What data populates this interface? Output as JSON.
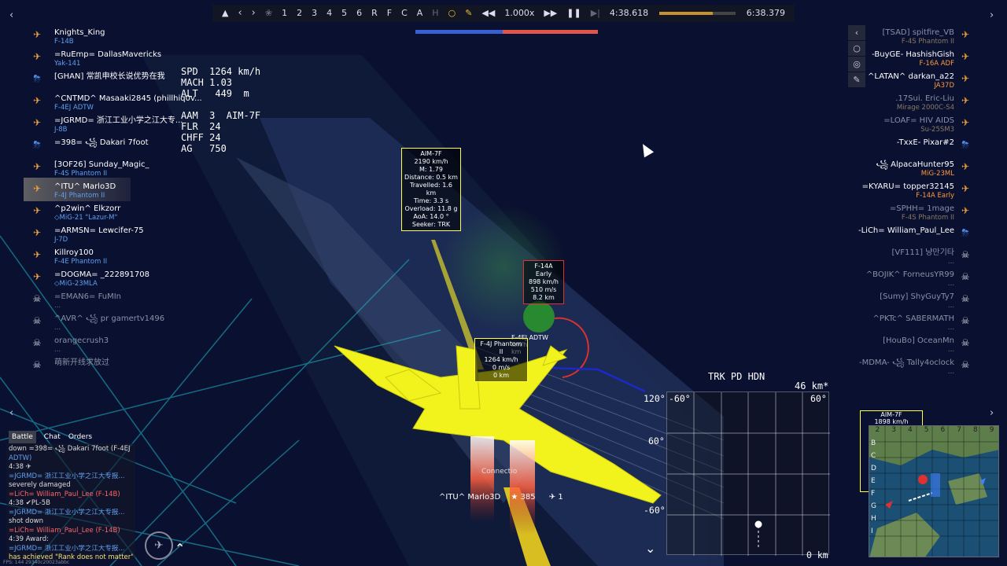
{
  "replay": {
    "items": [
      "1",
      "2",
      "3",
      "4",
      "5",
      "6",
      "R",
      "F",
      "C",
      "A"
    ],
    "speed": "1.000x",
    "current_time": "4:38.618",
    "total_time": "6:38.379",
    "progress": 0.7
  },
  "left_players": [
    {
      "name": "Knights_King",
      "vehicle": "F-14B",
      "state": "alive"
    },
    {
      "name": "=RuEmp= DallasMavericks",
      "vehicle": "Yak-141",
      "state": "alive"
    },
    {
      "name": "[GHAN] 常凯申校长说优势在我",
      "vehicle": "",
      "state": "para"
    },
    {
      "name": "^CNTMD^ Masaaki2845 (phillhiq0v...",
      "vehicle": "F-4EJ ADTW",
      "state": "alive"
    },
    {
      "name": "=JGRMD= 浙江工业小学之江大专...",
      "vehicle": "J-8B",
      "state": "alive"
    },
    {
      "name": "=398= ꧁ Dakari 7foot",
      "vehicle": "",
      "state": "para"
    },
    {
      "name": "[3OF26] Sunday_Magic_",
      "vehicle": "F-4S Phantom II",
      "state": "alive"
    },
    {
      "name": "^ITU^ Marlo3D",
      "vehicle": "F-4J Phantom II",
      "state": "alive"
    },
    {
      "name": "^p2win^ Elkzorr",
      "vehicle": "◇MiG-21 \"Lazur-M\"",
      "state": "alive"
    },
    {
      "name": "=ARMSN= Lewcifer-75",
      "vehicle": "J-7D",
      "state": "alive"
    },
    {
      "name": "Killroy100",
      "vehicle": "F-4E Phantom II",
      "state": "alive"
    },
    {
      "name": "=DOGMA= _222891708",
      "vehicle": "◇MiG-23MLA",
      "state": "alive"
    },
    {
      "name": "=EMAN6= FuMIn",
      "vehicle": "...",
      "state": "dead"
    },
    {
      "name": "^AVR^ ꧁ pr gamertv1496",
      "vehicle": "...",
      "state": "dead"
    },
    {
      "name": "orangecrush3",
      "vehicle": "...",
      "state": "dead"
    },
    {
      "name": "萌新开线求放过",
      "vehicle": "",
      "state": "dead"
    }
  ],
  "right_players": [
    {
      "name": "[TSAD] spitfire_VB",
      "vehicle": "F-4S Phantom II",
      "state": "dimalive"
    },
    {
      "name": "-BuyGE- HashishGish",
      "vehicle": "F-16A ADF",
      "state": "alive"
    },
    {
      "name": "^LATAN^ darkan_a22",
      "vehicle": "JA37D",
      "state": "alive"
    },
    {
      "name": ".17Sui. Eric-Liu",
      "vehicle": "Mirage 2000C-S4",
      "state": "dimalive"
    },
    {
      "name": "=LOAF= HIV AIDS",
      "vehicle": "Su-25SM3",
      "state": "dimalive"
    },
    {
      "name": "-TxxE- Pixar#2",
      "vehicle": "",
      "state": "para"
    },
    {
      "name": "꧁ AlpacaHunter95",
      "vehicle": "MiG-23ML",
      "state": "alive"
    },
    {
      "name": "=KYARU= topper32145",
      "vehicle": "F-14A Early",
      "state": "alive"
    },
    {
      "name": "=SPHH= 1mage",
      "vehicle": "F-4S Phantom II",
      "state": "dimalive"
    },
    {
      "name": "-LiCh= William_Paul_Lee",
      "vehicle": "",
      "state": "para"
    },
    {
      "name": "[VF111] 냥만기타",
      "vehicle": "...",
      "state": "dead"
    },
    {
      "name": "^BOJIK^ ForneusYR99",
      "vehicle": "...",
      "state": "dead"
    },
    {
      "name": "[Sumy] ShyGuyTy7",
      "vehicle": "...",
      "state": "dead"
    },
    {
      "name": "^PKTc^ SABERMATH",
      "vehicle": "...",
      "state": "dead"
    },
    {
      "name": "[HouBo] OceanMn",
      "vehicle": "...",
      "state": "dead"
    },
    {
      "name": "-MDMA- ꧁ Tally4oclock",
      "vehicle": "...",
      "state": "dead"
    }
  ],
  "hud": {
    "spd": "SPD  1264 km/h",
    "mach": "MACH 1.03",
    "alt": "ALT   449  m",
    "aam": "AAM  3  AIM-7F",
    "flr": "FLR  24",
    "chff": "CHFF 24",
    "ag": "AG   750"
  },
  "missile_tag": [
    "AIM-7F",
    "2190 km/h",
    "M: 1.79",
    "Distance: 0.5 km",
    "Travelled: 1.6 km",
    "Time: 3.3 s",
    "Overload: 11.8 g",
    "AoA: 14.0 °",
    "Seeker: TRK"
  ],
  "enemy_tag": [
    "F-14A Early",
    "898 km/h",
    "510 m/s",
    "8.2 km"
  ],
  "self_tag": [
    "F-4J Phantom II",
    "1264 km/h",
    "0 m/s",
    "0 km"
  ],
  "ally_tag": [
    "F-4EJ ADTW",
    "km/h",
    "km"
  ],
  "radar": {
    "title": "TRK PD HDN",
    "range": "46 km*",
    "zero": "0 km",
    "top_left": "-60°",
    "top_right": "60°",
    "left_120": "120°",
    "left_60": "60°",
    "left_m60": "-60°"
  },
  "minimap": {
    "tag": "AIM-7F",
    "tag_sub": "1898 km/h",
    "cols": [
      "2",
      "3",
      "4",
      "5",
      "6",
      "7",
      "8",
      "9"
    ],
    "rows": [
      "B",
      "C",
      "D",
      "E",
      "F",
      "G",
      "H",
      "I"
    ]
  },
  "chat": {
    "tabs": [
      "Battle",
      "Chat",
      "Orders"
    ],
    "lines": [
      {
        "c": "cw",
        "t": "down =398= ꧁ Dakari 7foot (F-4EJ"
      },
      {
        "c": "cb",
        "t": "ADTW)"
      },
      {
        "c": "cw",
        "t": "4:38 ✈"
      },
      {
        "c": "cb",
        "t": "=JGRMD= 浙江工业小学之江大专报..."
      },
      {
        "c": "cw",
        "t": "severely damaged"
      },
      {
        "c": "cr",
        "t": "=LiCh= William_Paul_Lee (F-14B)"
      },
      {
        "c": "cw",
        "t": "4:38 ✔PL-5B"
      },
      {
        "c": "cb",
        "t": "=JGRMD= 浙江工业小学之江大专报..."
      },
      {
        "c": "cw",
        "t": "shot down"
      },
      {
        "c": "cr",
        "t": "=LiCh= William_Paul_Lee (F-14B)"
      },
      {
        "c": "cw",
        "t": "4:39 Award:"
      },
      {
        "c": "cb",
        "t": "=JGRMD= 浙江工业小学之江大专报..."
      },
      {
        "c": "cy",
        "t": "has achieved \"Rank does not matter\""
      }
    ]
  },
  "bottom": {
    "player": "^ITU^ Marlo3D",
    "score": "385",
    "planes": "1",
    "connection": "Connectio",
    "fps": "FPS: 144     29340c20023abbc"
  },
  "colors": {
    "blue_team": "#3a5fd0",
    "red_team": "#e0564c",
    "hud_yellow": "#ffff3a",
    "enemy_red": "#e03030"
  },
  "team_balance": {
    "blue": 0.48,
    "red": 0.52
  }
}
